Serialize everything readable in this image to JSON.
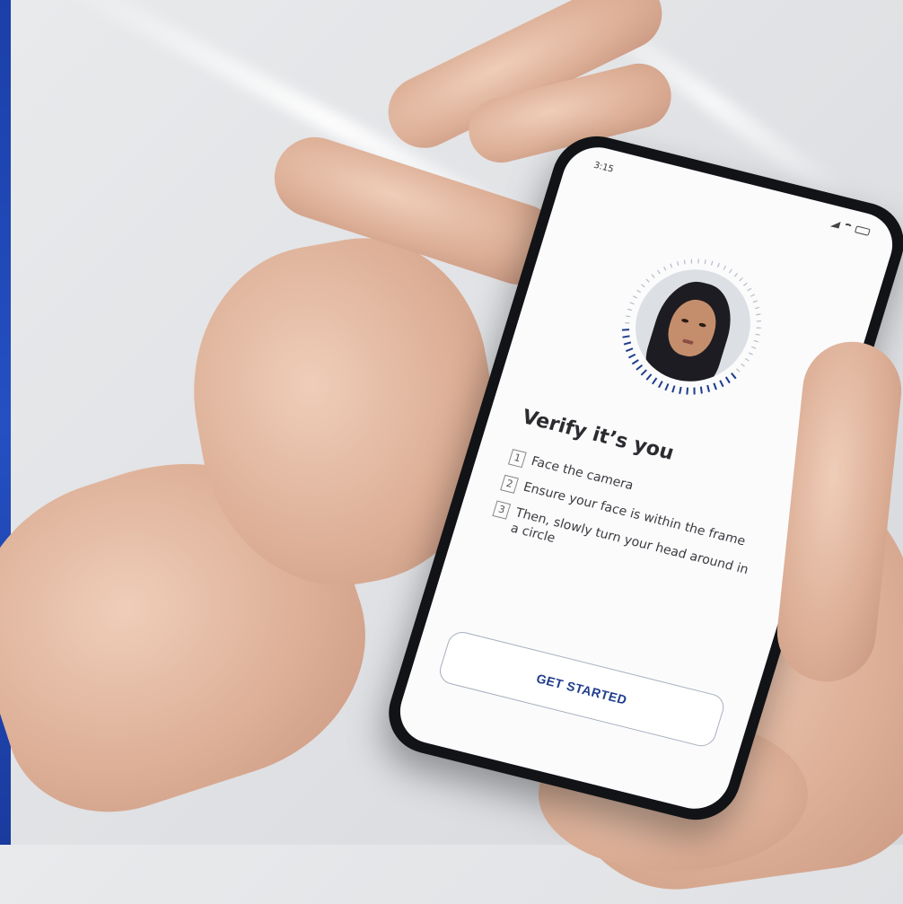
{
  "status_bar": {
    "time": "3:15",
    "icons": [
      "signal-icon",
      "wifi-icon",
      "battery-icon"
    ]
  },
  "verify": {
    "title": "Verify it’s you",
    "steps": [
      {
        "num": "1",
        "text": "Face the camera"
      },
      {
        "num": "2",
        "text": "Ensure your face is within the frame"
      },
      {
        "num": "3",
        "text": "Then, slowly turn your head around in a circle"
      }
    ],
    "button_label": "GET STARTED"
  },
  "colors": {
    "accent": "#1f3c8c",
    "edge": "#2450c2"
  }
}
